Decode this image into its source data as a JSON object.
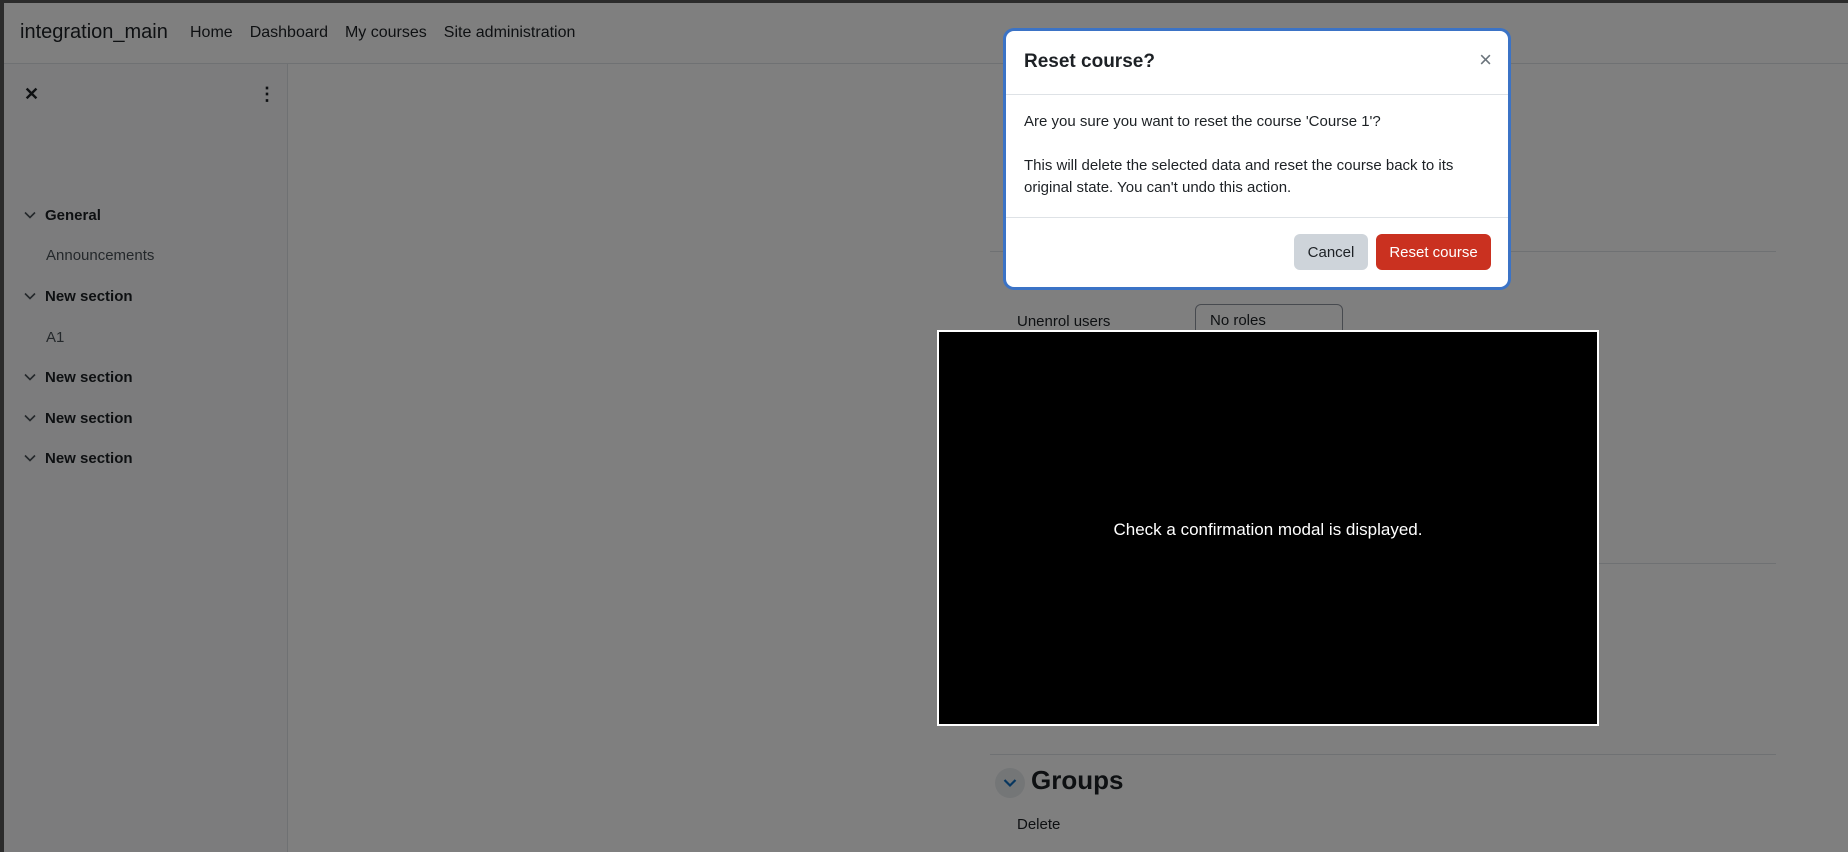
{
  "navbar": {
    "brand": "integration_main",
    "links": [
      "Home",
      "Dashboard",
      "My courses",
      "Site administration"
    ]
  },
  "drawer": {
    "items": [
      {
        "type": "section",
        "label": "General"
      },
      {
        "type": "item",
        "label": "Announcements"
      },
      {
        "type": "section",
        "label": "New section"
      },
      {
        "type": "item",
        "label": "A1"
      },
      {
        "type": "section",
        "label": "New section"
      },
      {
        "type": "section",
        "label": "New section"
      },
      {
        "type": "section",
        "label": "New section"
      }
    ]
  },
  "main": {
    "unenrol_label": "Unenrol users",
    "roles_select_value": "No roles",
    "groups_heading": "Groups",
    "groups_delete_label": "Delete"
  },
  "modal": {
    "title": "Reset course?",
    "close_glyph": "×",
    "body_line1": "Are you sure you want to reset the course 'Course 1'?",
    "body_line2": "This will delete the selected data and reset the course back to its original state. You can't undo this action.",
    "cancel_label": "Cancel",
    "reset_label": "Reset course"
  },
  "overlay_note": "Check a confirmation modal is displayed.",
  "colors": {
    "danger": "#ca3120",
    "secondary": "#ced4da",
    "focus_ring": "#3b73c6"
  }
}
